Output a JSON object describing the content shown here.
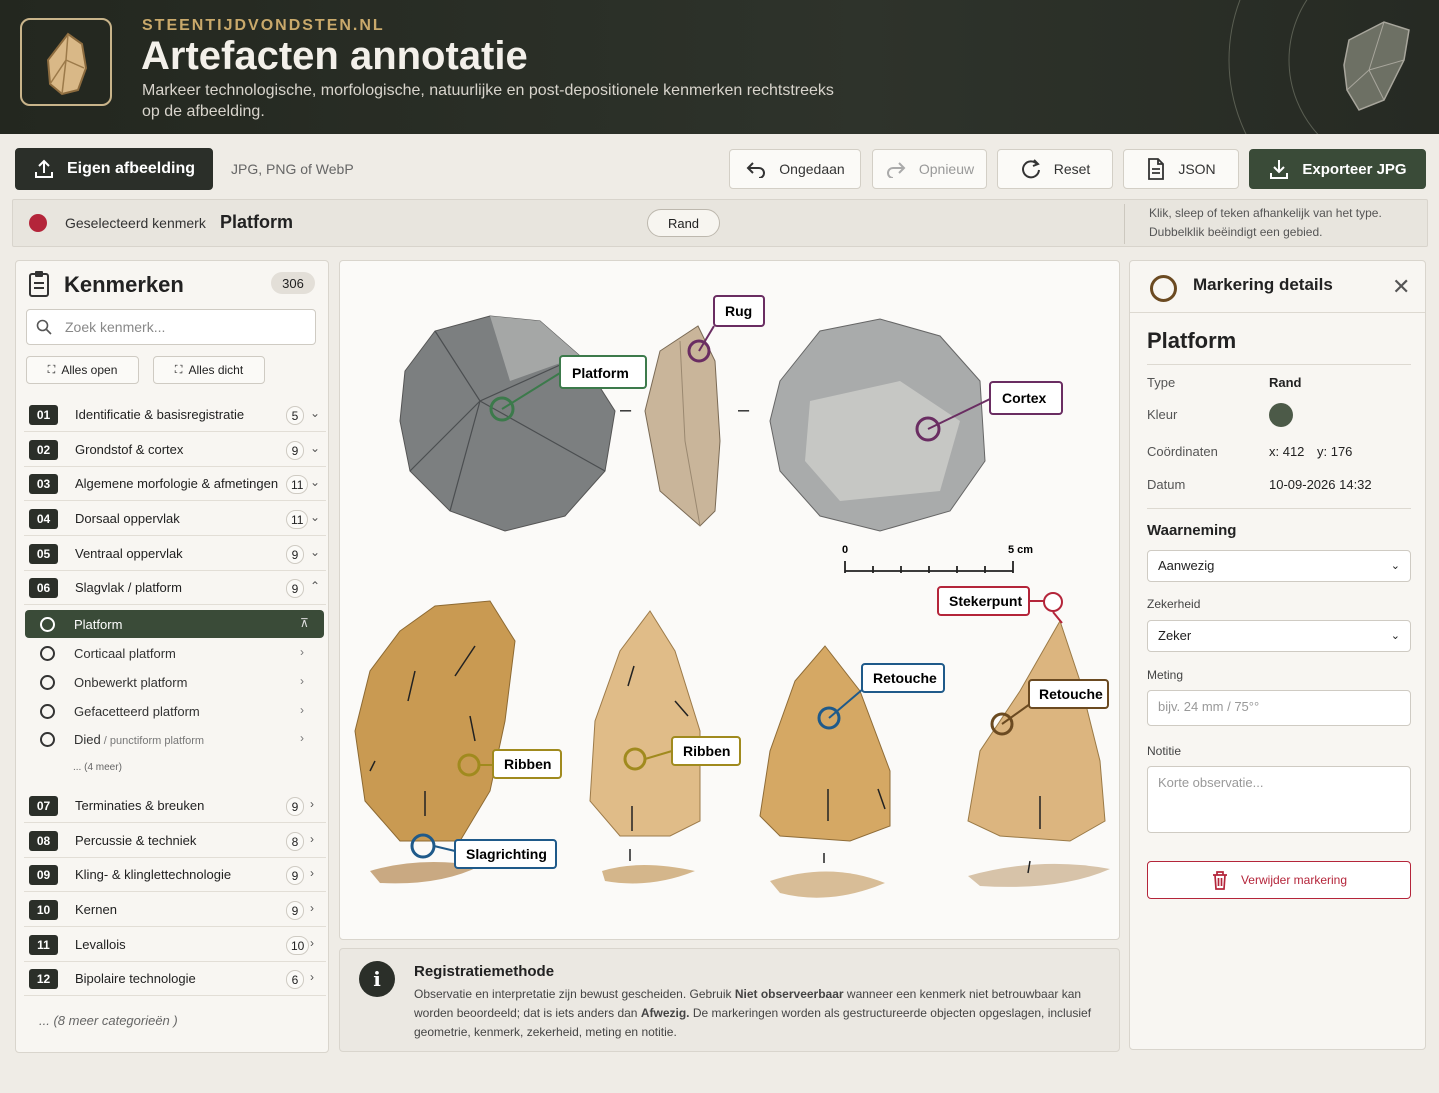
{
  "header": {
    "brand": "STEENTIJDVONDSTEN.NL",
    "title": "Artefacten annotatie",
    "subtitle": "Markeer technologische, morfologische, natuurlijke en post-depositionele kenmerken rechtstreeks op de afbeelding."
  },
  "toolbar": {
    "upload_label": "Eigen afbeelding",
    "formats": "JPG, PNG of WebP",
    "undo_label": "Ongedaan",
    "redo_label": "Opnieuw",
    "reset_label": "Reset",
    "json_label": "JSON",
    "export_label": "Exporteer JPG"
  },
  "selection": {
    "label": "Geselecteerd kenmerk",
    "value": "Platform",
    "type_chip": "Rand",
    "hint": "Klik, sleep of teken afhankelijk van het type. Dubbelklik beëindigt een gebied.",
    "color": "#b4253a"
  },
  "sidebar": {
    "title": "Kenmerken",
    "count": "306",
    "search_placeholder": "Zoek kenmerk...",
    "expand_all": "Alles open",
    "collapse_all": "Alles dicht",
    "categories": [
      {
        "num": "01",
        "label": "Identificatie & basisregistratie",
        "count": "5"
      },
      {
        "num": "02",
        "label": "Grondstof & cortex",
        "count": "9"
      },
      {
        "num": "03",
        "label": "Algemene morfologie & afmetingen",
        "count": "11"
      },
      {
        "num": "04",
        "label": "Dorsaal oppervlak",
        "count": "11"
      },
      {
        "num": "05",
        "label": "Ventraal oppervlak",
        "count": "9"
      },
      {
        "num": "06",
        "label": "Slagvlak / platform",
        "count": "9"
      },
      {
        "num": "07",
        "label": "Terminaties & breuken",
        "count": "9"
      },
      {
        "num": "08",
        "label": "Percussie & techniek",
        "count": "8"
      },
      {
        "num": "09",
        "label": "Kling- & klinglettechnologie",
        "count": "9"
      },
      {
        "num": "10",
        "label": "Kernen",
        "count": "9"
      },
      {
        "num": "11",
        "label": "Levallois",
        "count": "10"
      },
      {
        "num": "12",
        "label": "Bipolaire technologie",
        "count": "6"
      }
    ],
    "subitems": [
      {
        "label": "Platform"
      },
      {
        "label": "Corticaal platform"
      },
      {
        "label": "Onbewerkt platform"
      },
      {
        "label": "Gefacetteerd platform"
      },
      {
        "label": "Died",
        "suffix": " / punctiform platform"
      }
    ],
    "more_subitems": "... (4 meer)",
    "more_categories": "... (8 meer categorieën )"
  },
  "annotations": {
    "platform": "Platform",
    "rug": "Rug",
    "cortex": "Cortex",
    "stekerpunt": "Stekerpunt",
    "retouche1": "Retouche",
    "retouche2": "Retouche",
    "ribben1": "Ribben",
    "ribben2": "Ribben",
    "slagrichting": "Slagrichting",
    "scale_zero": "0",
    "scale_max": "5 cm",
    "dash": "–"
  },
  "details": {
    "title": "Markering details",
    "name": "Platform",
    "type_key": "Type",
    "type_val": "Rand",
    "color_key": "Kleur",
    "color_val": "#4c5a48",
    "coord_key": "Coördinaten",
    "coord_x": "x: 412",
    "coord_y": "y: 176",
    "date_key": "Datum",
    "date_val": "10-09-2026 14:32",
    "observation_title": "Waarneming",
    "observation_val": "Aanwezig",
    "certainty_label": "Zekerheid",
    "certainty_val": "Zeker",
    "measure_label": "Meting",
    "measure_placeholder": "bijv. 24 mm / 75°°",
    "note_label": "Notitie",
    "note_placeholder": "Korte observatie...",
    "delete_label": "Verwijder markering"
  },
  "info": {
    "title": "Registratiemethode",
    "t1": "Observatie en interpretatie zijn bewust gescheiden. Gebruik ",
    "b1": "Niet observeerbaar",
    "t2": " wanneer een kenmerk niet betrouwbaar kan worden beoordeeld; dat is iets anders dan ",
    "b2": "Afwezig.",
    "t3": " De markeringen worden als gestructureerde objecten opgeslagen, inclusief geometrie, kenmerk, zekerheid, meting en notitie."
  }
}
